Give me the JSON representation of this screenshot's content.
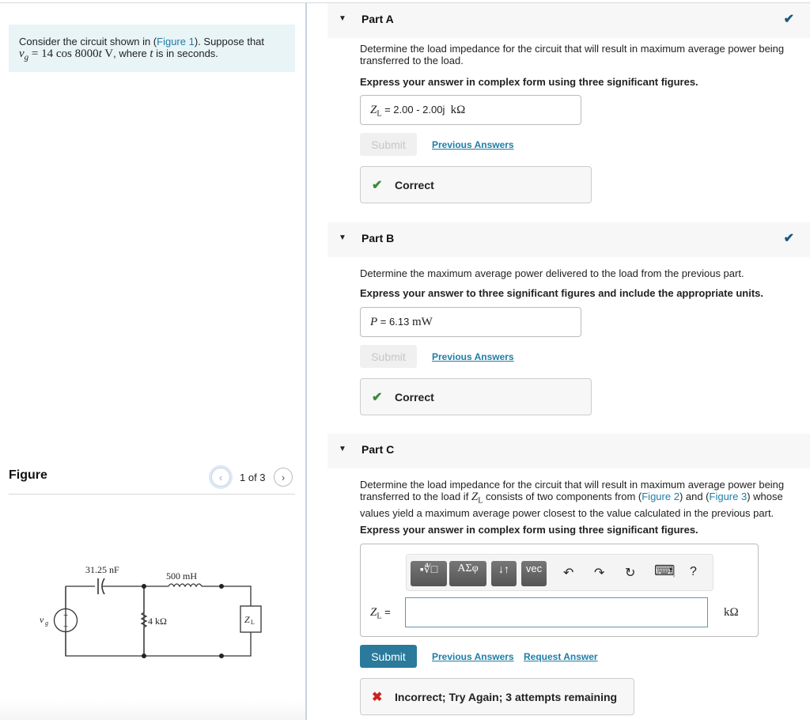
{
  "problem": {
    "text_before": "Consider the circuit shown in (",
    "figure_link": "Figure 1",
    "text_after": "). Suppose that",
    "vg_var": "v",
    "vg_sub": "g",
    "vg_expr": " = 14 cos 8000",
    "t_var": "t",
    "vg_unit": " V",
    "where_text": ", where ",
    "seconds_text": " is in seconds."
  },
  "figure": {
    "title": "Figure",
    "prev_icon": "‹",
    "next_icon": "›",
    "counter": "1 of 3",
    "circuit": {
      "capacitor": "31.25 nF",
      "inductor": "500 mH",
      "resistor": "4 kΩ",
      "source": "v",
      "source_sub": "g",
      "load": "Z",
      "load_sub": "L"
    }
  },
  "parts": [
    {
      "title": "Part A",
      "caret": "▼",
      "status_icon": "✔",
      "question": "Determine the load impedance for the circuit that will result in maximum average power being transferred to the load.",
      "instruction": "Express your answer in complex form using three significant figures.",
      "answer_var": "Z",
      "answer_sub": "L",
      "answer_eq": " = ",
      "answer_value": "2.00 - 2.00j",
      "answer_unit": "kΩ",
      "submit_label": "Submit",
      "previous_answers": "Previous Answers",
      "feedback_icon": "✔",
      "feedback": "Correct"
    },
    {
      "title": "Part B",
      "caret": "▼",
      "status_icon": "✔",
      "question": "Determine the maximum average power delivered to the load from the previous part.",
      "instruction": "Express your answer to three significant figures and include the appropriate units.",
      "answer_var": "P",
      "answer_eq": " = ",
      "answer_value": "6.13",
      "answer_unit": "mW",
      "submit_label": "Submit",
      "previous_answers": "Previous Answers",
      "feedback_icon": "✔",
      "feedback": "Correct"
    },
    {
      "title": "Part C",
      "caret": "▼",
      "q_part1": "Determine the load impedance for the circuit that will result in maximum average power being transferred to the load if ",
      "q_var": "Z",
      "q_sub": "L",
      "q_part2": " consists of two components from (",
      "fig2": "Figure 2",
      "q_part3": ") and (",
      "fig3": "Figure 3",
      "q_part4": ") whose values yield a maximum average power closest to the value calculated in the previous part.",
      "instruction": "Express your answer in complex form using three significant figures.",
      "toolbar": {
        "templates_label": "▪∜□",
        "greek_label": "ΑΣφ",
        "arrows_label": "↓↑",
        "vec_label": "vec",
        "undo_icon": "↶",
        "redo_icon": "↷",
        "reset_icon": "↻",
        "keyboard_icon": "⌨",
        "help_label": "?"
      },
      "answer_var": "Z",
      "answer_sub": "L",
      "answer_eq": " =",
      "answer_value": "",
      "answer_unit": "kΩ",
      "submit_label": "Submit",
      "previous_answers": "Previous Answers",
      "request_answer": "Request Answer",
      "feedback_icon": "✖",
      "feedback": "Incorrect; Try Again; 3 attempts remaining"
    }
  ],
  "colors": {
    "accent": "#2a7a9c",
    "link": "#1f7da6",
    "correct": "#3a8a3a",
    "incorrect": "#cc2222",
    "status_check": "#1c5a7a"
  }
}
